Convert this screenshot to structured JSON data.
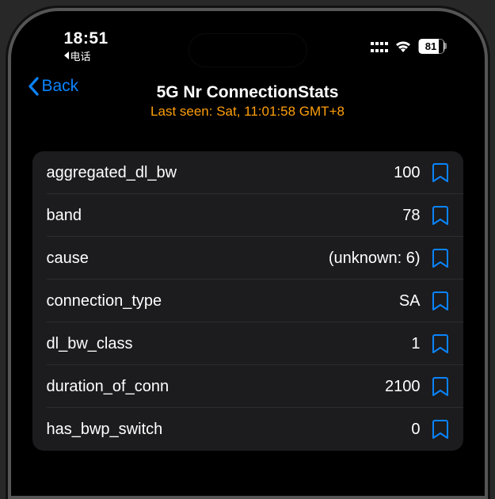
{
  "status_bar": {
    "time": "18:51",
    "callback_app": "电话",
    "battery": "81"
  },
  "nav": {
    "back_label": "Back",
    "title": "5G Nr ConnectionStats",
    "subtitle": "Last seen: Sat, 11:01:58 GMT+8"
  },
  "rows": [
    {
      "label": "aggregated_dl_bw",
      "value": "100"
    },
    {
      "label": "band",
      "value": "78"
    },
    {
      "label": "cause",
      "value": "(unknown: 6)"
    },
    {
      "label": "connection_type",
      "value": "SA"
    },
    {
      "label": "dl_bw_class",
      "value": "1"
    },
    {
      "label": "duration_of_conn",
      "value": "2100"
    },
    {
      "label": "has_bwp_switch",
      "value": "0"
    }
  ]
}
